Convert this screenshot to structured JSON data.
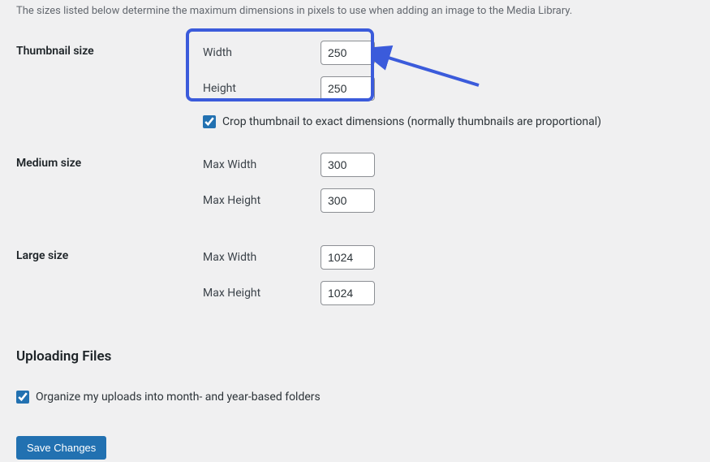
{
  "description": "The sizes listed below determine the maximum dimensions in pixels to use when adding an image to the Media Library.",
  "thumbnail": {
    "section_label": "Thumbnail size",
    "width_label": "Width",
    "width_value": "250",
    "height_label": "Height",
    "height_value": "250",
    "crop_label": "Crop thumbnail to exact dimensions (normally thumbnails are proportional)"
  },
  "medium": {
    "section_label": "Medium size",
    "max_width_label": "Max Width",
    "max_width_value": "300",
    "max_height_label": "Max Height",
    "max_height_value": "300"
  },
  "large": {
    "section_label": "Large size",
    "max_width_label": "Max Width",
    "max_width_value": "1024",
    "max_height_label": "Max Height",
    "max_height_value": "1024"
  },
  "uploading": {
    "heading": "Uploading Files",
    "organize_label": "Organize my uploads into month- and year-based folders"
  },
  "save_button": "Save Changes"
}
